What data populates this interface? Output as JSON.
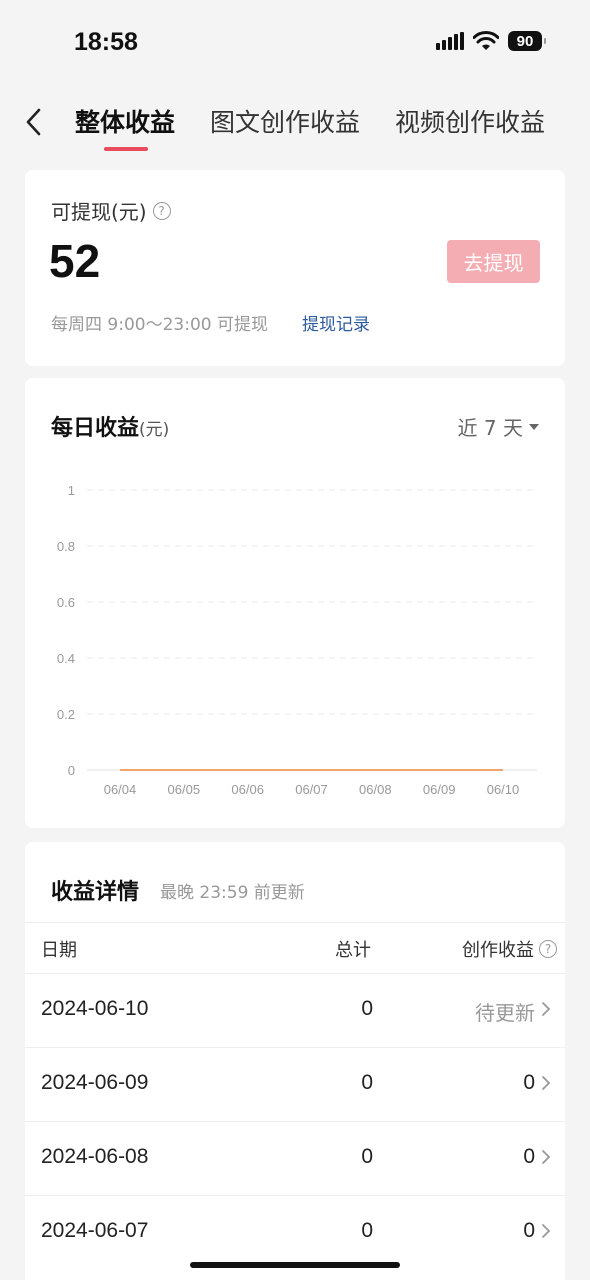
{
  "status_bar": {
    "time": "18:58",
    "battery": "90"
  },
  "nav": {
    "tabs": [
      {
        "label": "整体收益",
        "active": true
      },
      {
        "label": "图文创作收益",
        "active": false
      },
      {
        "label": "视频创作收益",
        "active": false
      }
    ]
  },
  "withdraw": {
    "label": "可提现(元)",
    "amount": "52",
    "button_label": "去提现",
    "note": "每周四 9:00～23:00 可提现",
    "record_link": "提现记录"
  },
  "daily": {
    "title": "每日收益",
    "unit": "(元)",
    "range": "近 7 天"
  },
  "chart_data": {
    "type": "line",
    "x": [
      "06/04",
      "06/05",
      "06/06",
      "06/07",
      "06/08",
      "06/09",
      "06/10"
    ],
    "series": [
      {
        "values": [
          0,
          0,
          0,
          0,
          0,
          0,
          0
        ],
        "color": "#f0a36b"
      }
    ],
    "yticks": [
      "0",
      "0.2",
      "0.4",
      "0.6",
      "0.8",
      "1"
    ],
    "ylim": [
      0,
      1
    ],
    "grid": true
  },
  "details": {
    "title": "收益详情",
    "subtitle": "最晚 23:59 前更新",
    "headers": {
      "date": "日期",
      "total": "总计",
      "creation": "创作收益"
    },
    "rows": [
      {
        "date": "2024-06-10",
        "total": "0",
        "creation": "待更新"
      },
      {
        "date": "2024-06-09",
        "total": "0",
        "creation": "0"
      },
      {
        "date": "2024-06-08",
        "total": "0",
        "creation": "0"
      },
      {
        "date": "2024-06-07",
        "total": "0",
        "creation": "0"
      }
    ]
  },
  "colors": {
    "accent": "#e84b5b",
    "button_disabled": "#f4adb2",
    "link": "#2b5b9c",
    "line": "#f0a36b"
  }
}
